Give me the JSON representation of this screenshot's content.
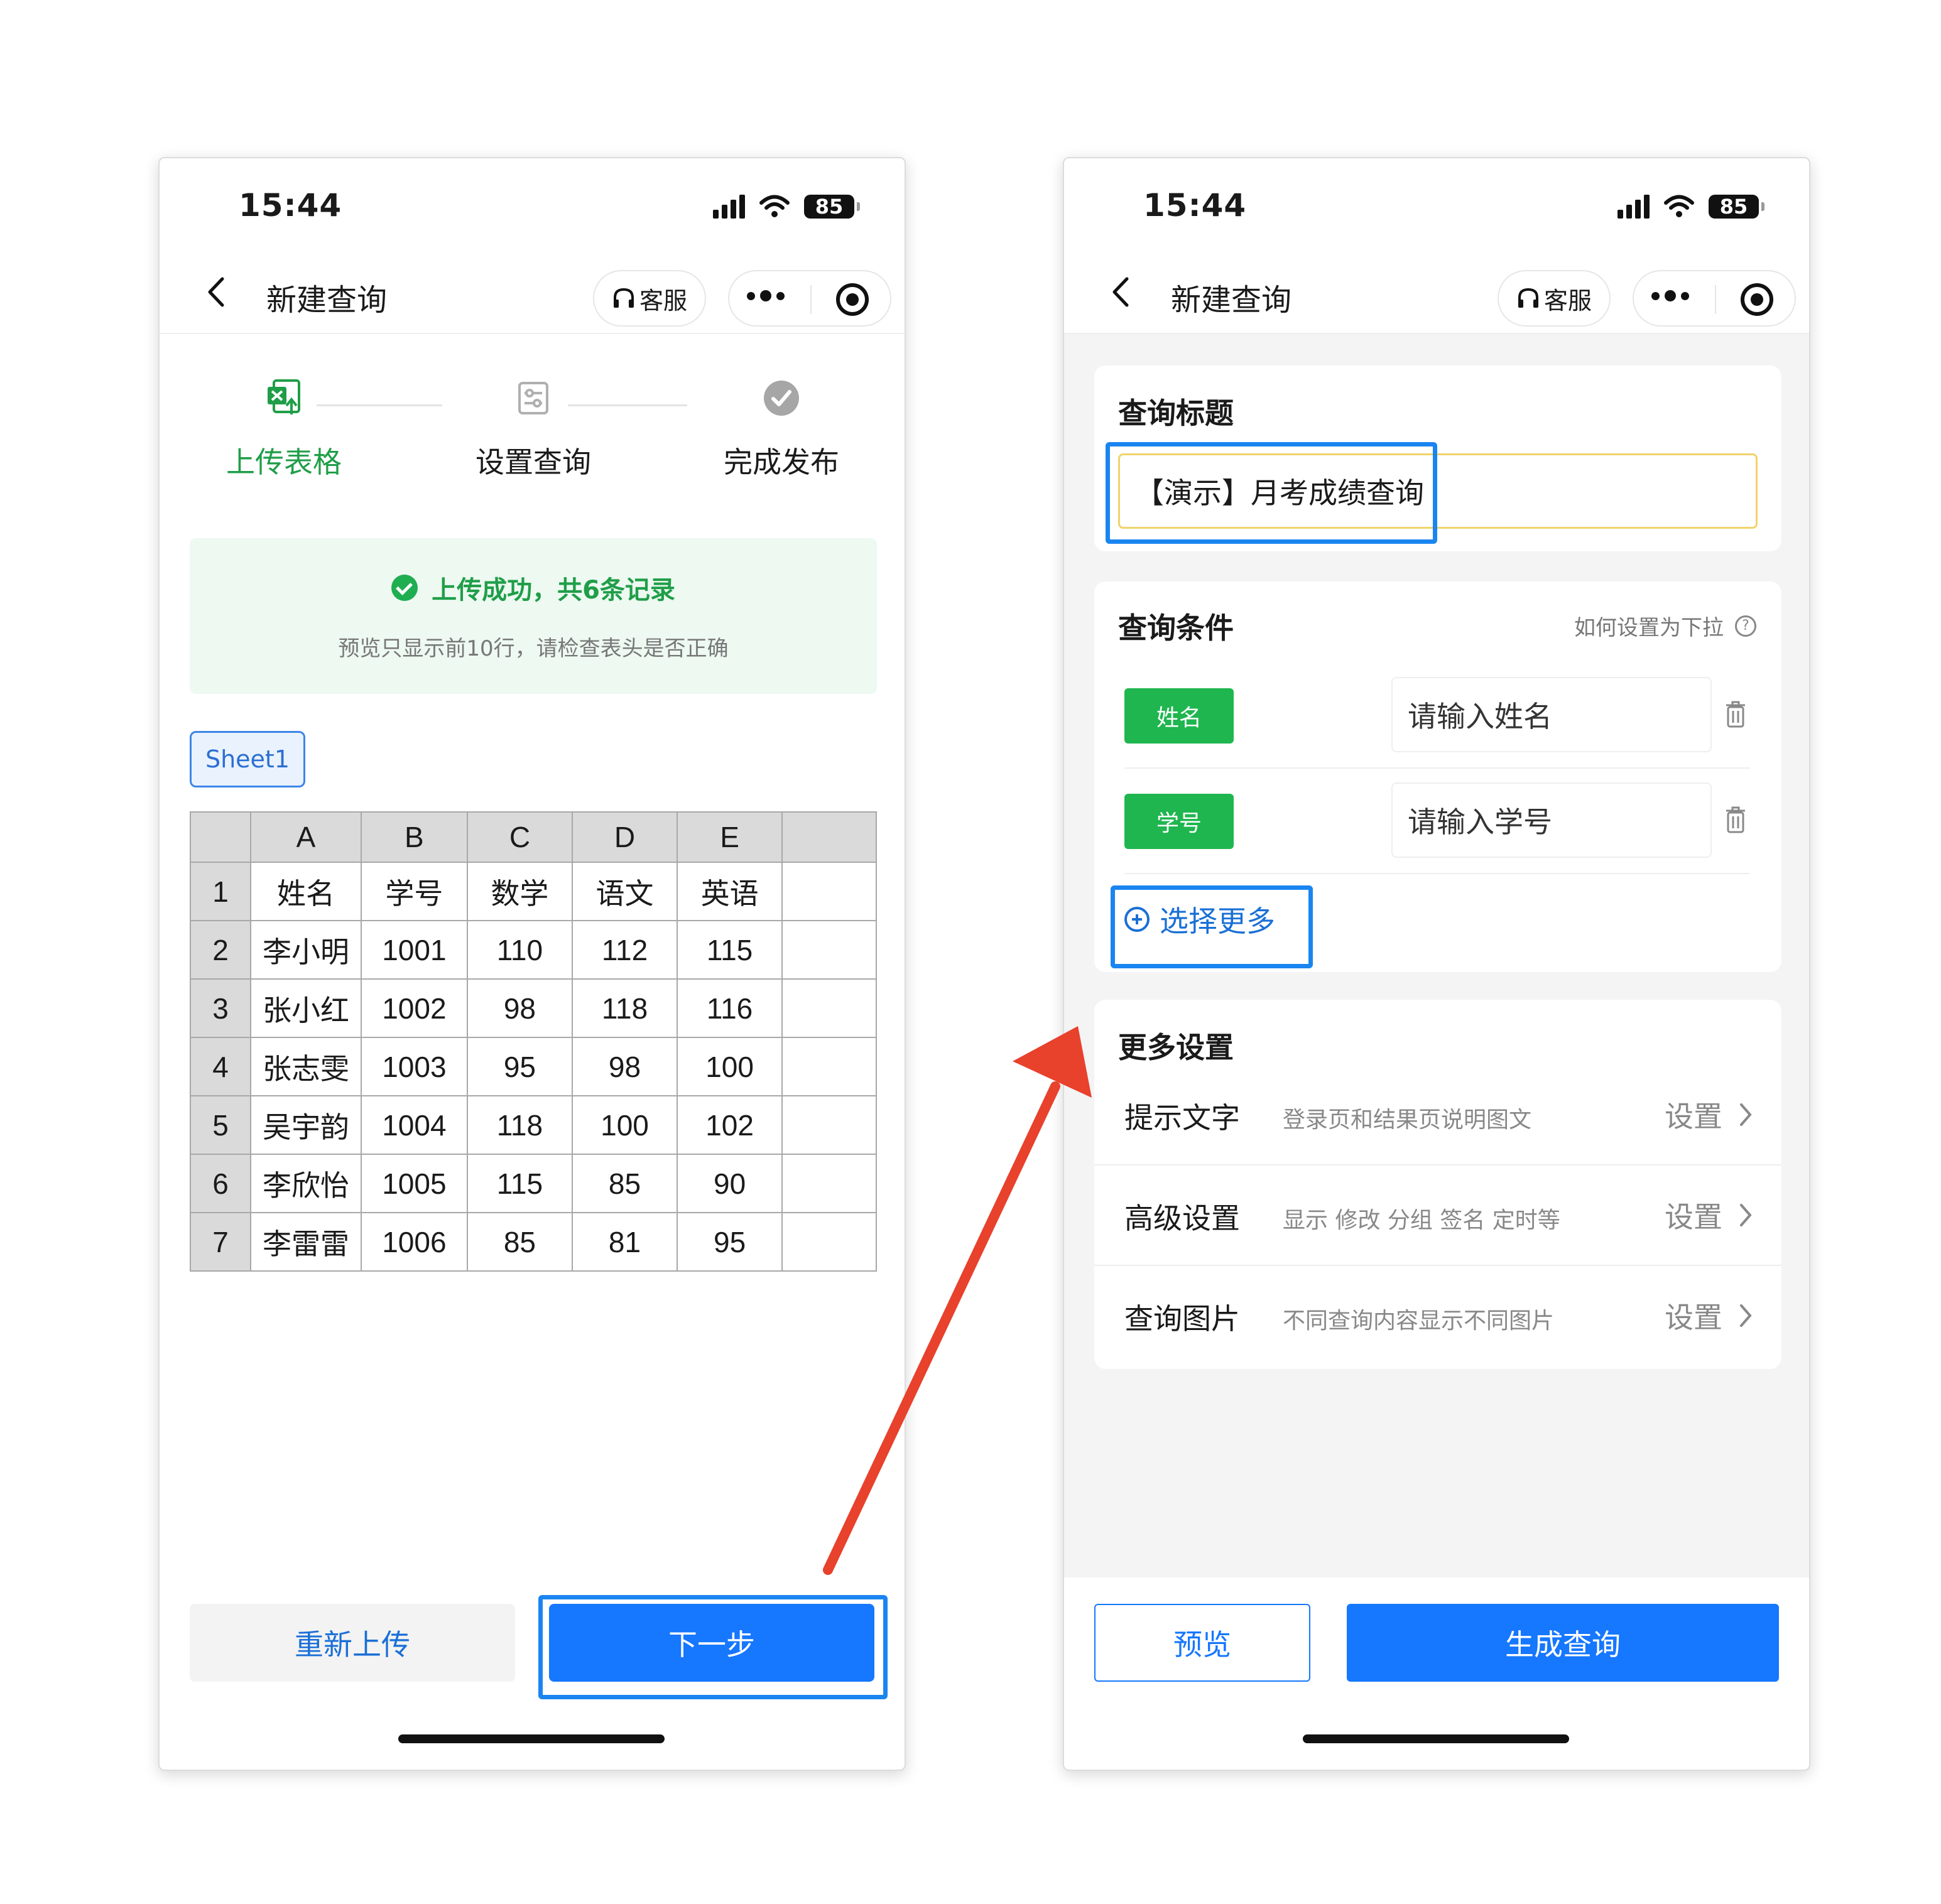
{
  "common": {
    "status_time": "15:44",
    "battery_level": "85",
    "nav_title": "新建查询",
    "service_label": "客服"
  },
  "left": {
    "steps": [
      "上传表格",
      "设置查询",
      "完成发布"
    ],
    "success_title": "上传成功，共6条记录",
    "success_sub": "预览只显示前10行，请检查表头是否正确",
    "sheet_tab": "Sheet1",
    "table": {
      "columns": [
        "A",
        "B",
        "C",
        "D",
        "E"
      ],
      "rows": [
        {
          "num": "1",
          "cells": [
            "姓名",
            "学号",
            "数学",
            "语文",
            "英语"
          ]
        },
        {
          "num": "2",
          "cells": [
            "李小明",
            "1001",
            "110",
            "112",
            "115"
          ]
        },
        {
          "num": "3",
          "cells": [
            "张小红",
            "1002",
            "98",
            "118",
            "116"
          ]
        },
        {
          "num": "4",
          "cells": [
            "张志雯",
            "1003",
            "95",
            "98",
            "100"
          ]
        },
        {
          "num": "5",
          "cells": [
            "吴宇韵",
            "1004",
            "118",
            "100",
            "102"
          ]
        },
        {
          "num": "6",
          "cells": [
            "李欣怡",
            "1005",
            "115",
            "85",
            "90"
          ]
        },
        {
          "num": "7",
          "cells": [
            "李雷雷",
            "1006",
            "85",
            "81",
            "95"
          ]
        }
      ]
    },
    "reupload_label": "重新上传",
    "next_label": "下一步"
  },
  "right": {
    "title_section": "查询标题",
    "title_value": "【演示】月考成绩查询",
    "conditions_section": "查询条件",
    "dropdown_help": "如何设置为下拉",
    "conditions": [
      {
        "tag": "姓名",
        "placeholder": "请输入姓名"
      },
      {
        "tag": "学号",
        "placeholder": "请输入学号"
      }
    ],
    "select_more": "选择更多",
    "more_settings_section": "更多设置",
    "settings": [
      {
        "name": "提示文字",
        "desc": "登录页和结果页说明图文",
        "action": "设置"
      },
      {
        "name": "高级设置",
        "desc": "显示 修改 分组 签名 定时等",
        "action": "设置"
      },
      {
        "name": "查询图片",
        "desc": "不同查询内容显示不同图片",
        "action": "设置"
      }
    ],
    "preview_label": "预览",
    "generate_label": "生成查询"
  },
  "colors": {
    "accent_blue": "#1677ff",
    "success_green": "#1f9e48",
    "tag_green": "#1fb64f",
    "arrow_red": "#e8412c"
  }
}
